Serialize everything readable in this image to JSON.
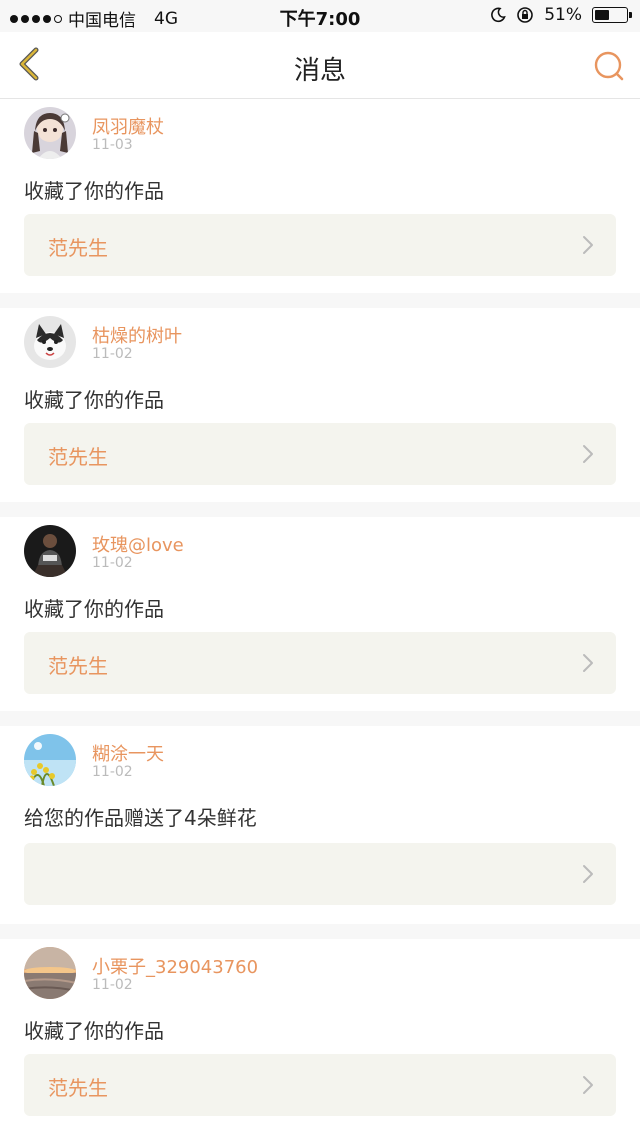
{
  "status_bar": {
    "carrier": "中国电信",
    "network": "4G",
    "time": "下午7:00",
    "battery_percent": "51%",
    "battery_level": 0.51
  },
  "nav": {
    "title": "消息",
    "back_icon": "chevron-left-icon",
    "search_icon": "search-icon"
  },
  "colors": {
    "accent": "#e8955f",
    "back_icon": "#d9b53a",
    "card_box": "#f4f4ee"
  },
  "notifications": [
    {
      "username": "凤羽魔杖",
      "date": "11-03",
      "message": "收藏了你的作品",
      "work_title": "范先生"
    },
    {
      "username": "枯燥的树叶",
      "date": "11-02",
      "message": "收藏了你的作品",
      "work_title": "范先生"
    },
    {
      "username": "玫瑰@love",
      "date": "11-02",
      "message": "收藏了你的作品",
      "work_title": "范先生"
    },
    {
      "username": "糊涂一天",
      "date": "11-02",
      "message": "给您的作品赠送了4朵鲜花",
      "work_title": ""
    },
    {
      "username": "小栗子_329043760",
      "date": "11-02",
      "message": "收藏了你的作品",
      "work_title": "范先生"
    }
  ]
}
